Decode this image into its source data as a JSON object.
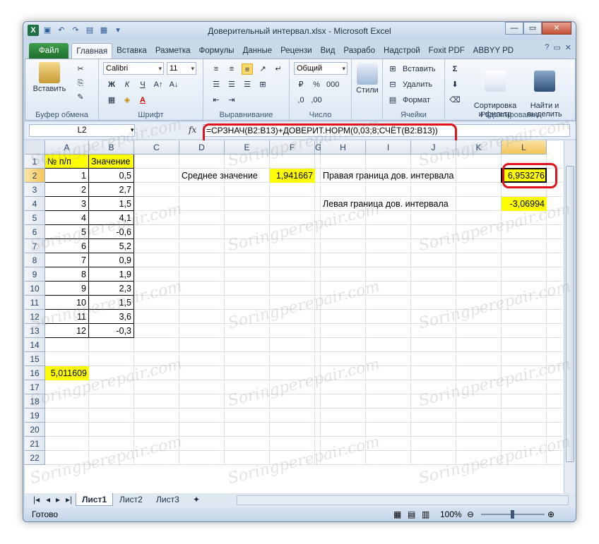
{
  "window": {
    "title": "Доверительный интервал.xlsx - Microsoft Excel",
    "min": "—",
    "max": "▭",
    "close": "✕"
  },
  "ribbon": {
    "tabs": [
      "Файл",
      "Главная",
      "Вставка",
      "Разметка",
      "Формулы",
      "Данные",
      "Рецензи",
      "Вид",
      "Разрабо",
      "Надстрой",
      "Foxit PDF",
      "ABBYY PD"
    ],
    "active_tab": "Главная",
    "groups": {
      "clipboard": {
        "label": "Буфер обмена",
        "paste": "Вставить"
      },
      "font": {
        "label": "Шрифт",
        "name": "Calibri",
        "size": "11",
        "bold": "Ж",
        "italic": "К",
        "underline": "Ч"
      },
      "alignment": {
        "label": "Выравнивание"
      },
      "number": {
        "label": "Число",
        "format": "Общий"
      },
      "styles": {
        "label": "Стили",
        "button": "Стили"
      },
      "cells": {
        "label": "Ячейки",
        "insert": "Вставить",
        "delete": "Удалить",
        "format": "Формат"
      },
      "editing": {
        "label": "Редактирование",
        "sort": "Сортировка\nи фильтр",
        "find": "Найти и\nвыделить"
      }
    }
  },
  "formula_bar": {
    "name_box": "L2",
    "fx": "fx",
    "formula": "=СРЗНАЧ(B2:B13)+ДОВЕРИТ.НОРМ(0,03;8;СЧЁТ(B2:B13))"
  },
  "sheet": {
    "columns": [
      "A",
      "B",
      "C",
      "D",
      "E",
      "F",
      "G",
      "H",
      "I",
      "J",
      "K",
      "L"
    ],
    "rows": [
      "1",
      "2",
      "3",
      "4",
      "5",
      "6",
      "7",
      "8",
      "9",
      "10",
      "11",
      "12",
      "13",
      "14",
      "15",
      "16",
      "17",
      "18",
      "19",
      "20",
      "21",
      "22"
    ],
    "header_a1": "№ п/п",
    "header_b1": "Значение",
    "table": [
      [
        "1",
        "0,5"
      ],
      [
        "2",
        "2,7"
      ],
      [
        "3",
        "1,5"
      ],
      [
        "4",
        "4,1"
      ],
      [
        "5",
        "-0,6"
      ],
      [
        "6",
        "5,2"
      ],
      [
        "7",
        "0,9"
      ],
      [
        "8",
        "1,9"
      ],
      [
        "9",
        "2,3"
      ],
      [
        "10",
        "1,5"
      ],
      [
        "11",
        "3,6"
      ],
      [
        "12",
        "-0,3"
      ]
    ],
    "a16": "5,011609",
    "mean_label": "Среднее значение",
    "mean_value": "1,941667",
    "right_label": "Правая граница дов. интервала",
    "right_value": "6,953276",
    "left_label": "Левая граница дов. интервала",
    "left_value": "-3,06994"
  },
  "sheet_tabs": [
    "Лист1",
    "Лист2",
    "Лист3"
  ],
  "status": {
    "ready": "Готово",
    "zoom": "100%"
  },
  "watermark": "Soringperepair.com"
}
